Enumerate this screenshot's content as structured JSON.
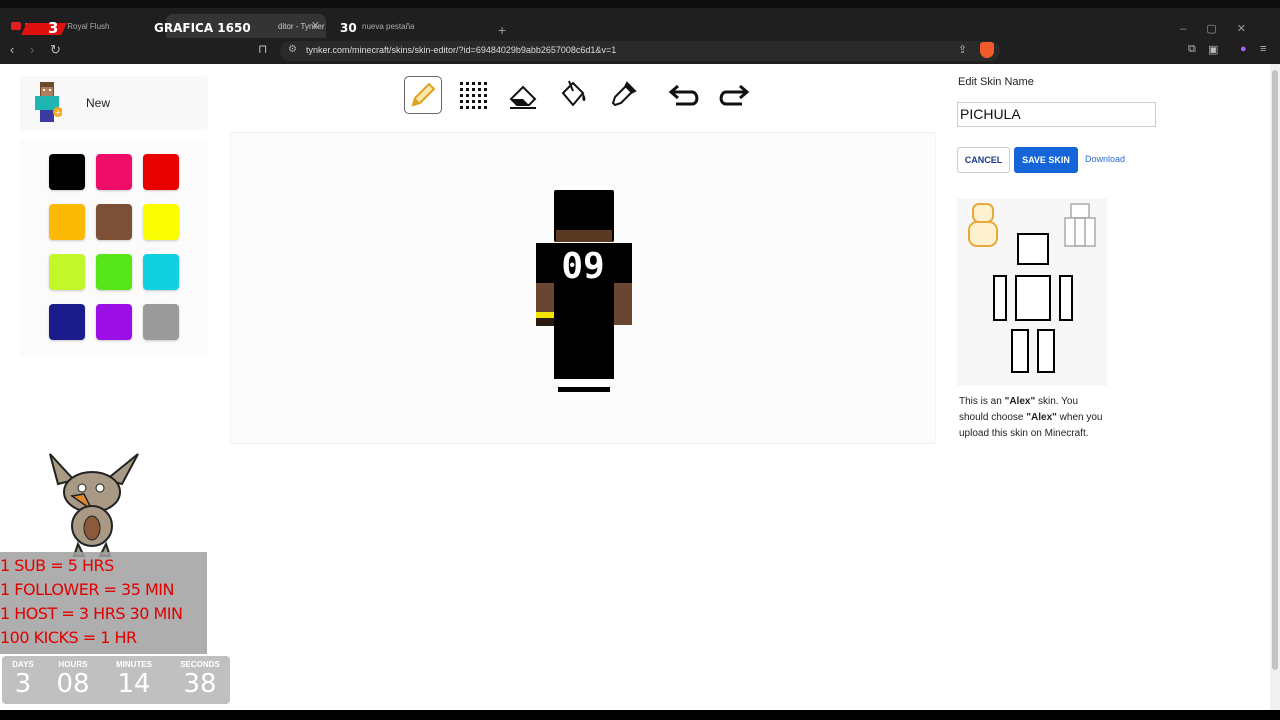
{
  "browser": {
    "tabs": [
      {
        "label": "Remmurd - Royal Flush",
        "stream_num": "3"
      },
      {
        "label": "GRAFICA 1650",
        "sub": "ditor - Tynker"
      },
      {
        "label": "nueva pestaña",
        "stream_num": "30"
      }
    ],
    "url": "tynker.com/minecraft/skins/skin-editor/?id=69484029b9abb2657008c6d1&v=1"
  },
  "left": {
    "new_label": "New",
    "palette": [
      "#000000",
      "#ee0e6a",
      "#e80000",
      "#fcba07",
      "#7b5037",
      "#fbfe00",
      "#c1f72b",
      "#56e61a",
      "#11d0e0",
      "#1b1b8c",
      "#9b0ee6",
      "#9b9b9b"
    ]
  },
  "tools": [
    "pencil-icon",
    "grid-icon",
    "eraser-icon",
    "bucket-icon",
    "eyedropper-icon",
    "undo-icon",
    "redo-icon"
  ],
  "right": {
    "title": "Edit Skin Name",
    "skin_name": "PICHULA",
    "cancel": "CANCEL",
    "save": "SAVE SKIN",
    "download": "Download",
    "desc_1": "This is an ",
    "desc_alex1": "\"Alex\"",
    "desc_2": " skin. You should choose ",
    "desc_alex2": "\"Alex\"",
    "desc_3": " when you upload this skin on Minecraft."
  },
  "skin": {
    "jersey_number": "09"
  },
  "overlay": {
    "rules": [
      "1 SUB = 5 HRS",
      "1 FOLLOWER = 35 MIN",
      "1 HOST = 3 HRS 30 MIN",
      "100 KICKS = 1 HR"
    ],
    "timer": [
      {
        "label": "DAYS",
        "value": "3"
      },
      {
        "label": "HOURS",
        "value": "08"
      },
      {
        "label": "MINUTES",
        "value": "14"
      },
      {
        "label": "SECONDS",
        "value": "38"
      }
    ]
  }
}
